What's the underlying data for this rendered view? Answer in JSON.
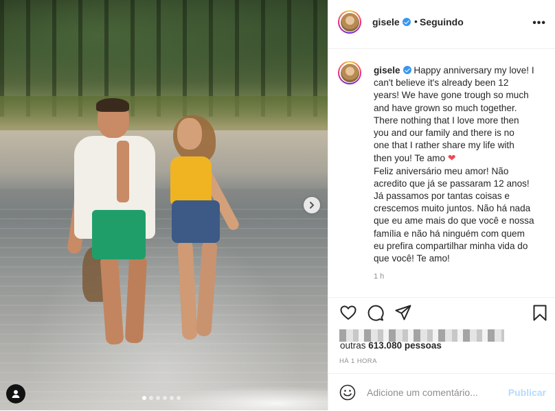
{
  "post": {
    "username": "gisele",
    "separator": "•",
    "follow_status": "Seguindo",
    "more_label": "•••",
    "caption_lines": [
      "Happy anniversary my love! I",
      "can't believe it's already been 12",
      "years! We have gone trough so much",
      "and have grown so much together.",
      "There nothing that I love more then",
      "you and our family and there is no",
      "one that I rather share my life with",
      "then you! Te amo",
      "Feliz aniversário meu amor! Não",
      "acredito que já se passaram 12 anos!",
      "Já passamos por tantas coisas e",
      "crescemos muito juntos. Não há nada",
      "que eu ame mais do que você e nossa",
      "família e não há ninguém com quem",
      "eu prefira compartilhar minha vida do",
      "que você! Te amo!"
    ],
    "heart_emoji": "❤",
    "time_since": "1 h",
    "likes_prefix": "outras ",
    "likes_count": "613.080",
    "likes_suffix": " pessoas",
    "posted_ago": "HÁ 1 HORA",
    "comment_placeholder": "Adicione um comentário...",
    "publish_label": "Publicar"
  },
  "carousel": {
    "slide_count": 6,
    "active_index": 0
  },
  "colors": {
    "verified": "#3897f0",
    "heart": "#ed4956",
    "publish_disabled": "#b3dbff",
    "muted_text": "#8e8e8e"
  },
  "icons": [
    "verified-badge-icon",
    "more-options-icon",
    "like-heart-icon",
    "comment-icon",
    "share-icon",
    "save-bookmark-icon",
    "emoji-icon",
    "next-arrow-icon",
    "tag-user-icon"
  ]
}
